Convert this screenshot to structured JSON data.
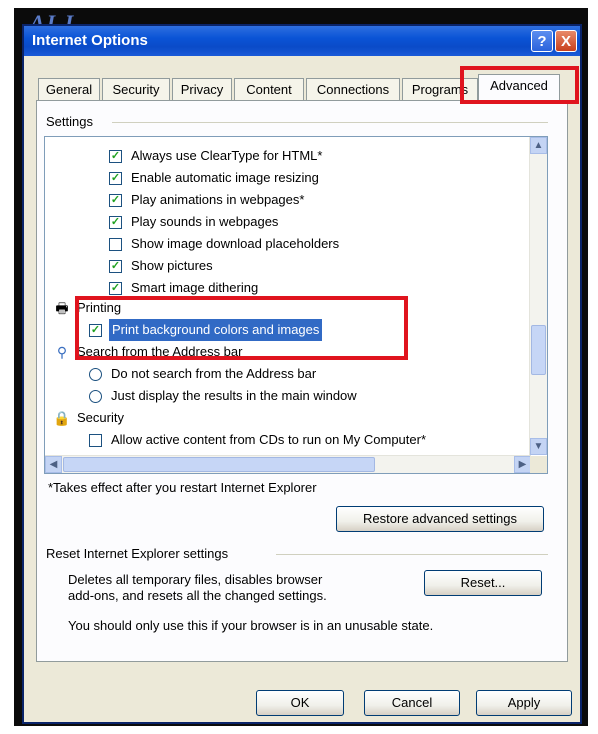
{
  "window": {
    "title": "Internet Options",
    "help": "?",
    "close": "X",
    "top_fragment": "AI I"
  },
  "tabs": [
    {
      "label": "General"
    },
    {
      "label": "Security"
    },
    {
      "label": "Privacy"
    },
    {
      "label": "Content"
    },
    {
      "label": "Connections"
    },
    {
      "label": "Programs"
    },
    {
      "label": "Advanced",
      "active": true
    }
  ],
  "settings": {
    "group_label": "Settings",
    "items": [
      {
        "type": "checkbox",
        "checked": true,
        "label": "Always use ClearType for HTML*"
      },
      {
        "type": "checkbox",
        "checked": true,
        "label": "Enable automatic image resizing"
      },
      {
        "type": "checkbox",
        "checked": true,
        "label": "Play animations in webpages*"
      },
      {
        "type": "checkbox",
        "checked": true,
        "label": "Play sounds in webpages"
      },
      {
        "type": "checkbox",
        "checked": false,
        "label": "Show image download placeholders"
      },
      {
        "type": "checkbox",
        "checked": true,
        "label": "Show pictures"
      },
      {
        "type": "checkbox",
        "checked": true,
        "label": "Smart image dithering"
      },
      {
        "type": "category",
        "icon": "printer-icon",
        "label": "Printing"
      },
      {
        "type": "checkbox",
        "checked": true,
        "selected": true,
        "label": "Print background colors and images"
      },
      {
        "type": "category",
        "icon": "search-icon",
        "label": "Search from the Address bar"
      },
      {
        "type": "radio",
        "checked": false,
        "label": "Do not search from the Address bar"
      },
      {
        "type": "radio",
        "checked": false,
        "label": "Just display the results in the main window"
      },
      {
        "type": "category",
        "icon": "lock-icon",
        "label": "Security"
      },
      {
        "type": "checkbox",
        "checked": false,
        "label": "Allow active content from CDs to run on My Computer*"
      }
    ],
    "footnote": "*Takes effect after you restart Internet Explorer",
    "restore_button": "Restore advanced settings"
  },
  "reset_section": {
    "group_label": "Reset Internet Explorer settings",
    "description_line1": "Deletes all temporary files, disables browser",
    "description_line2": "add-ons, and resets all the changed settings.",
    "reset_button": "Reset...",
    "warning": "You should only use this if your browser is in an unusable state."
  },
  "footer": {
    "ok": "OK",
    "cancel": "Cancel",
    "apply": "Apply"
  },
  "colors": {
    "annotation_red": "#e0141e",
    "titlebar_blue": "#0a54d6",
    "selection_blue": "#316ac5",
    "checkmark_green": "#21a121"
  }
}
